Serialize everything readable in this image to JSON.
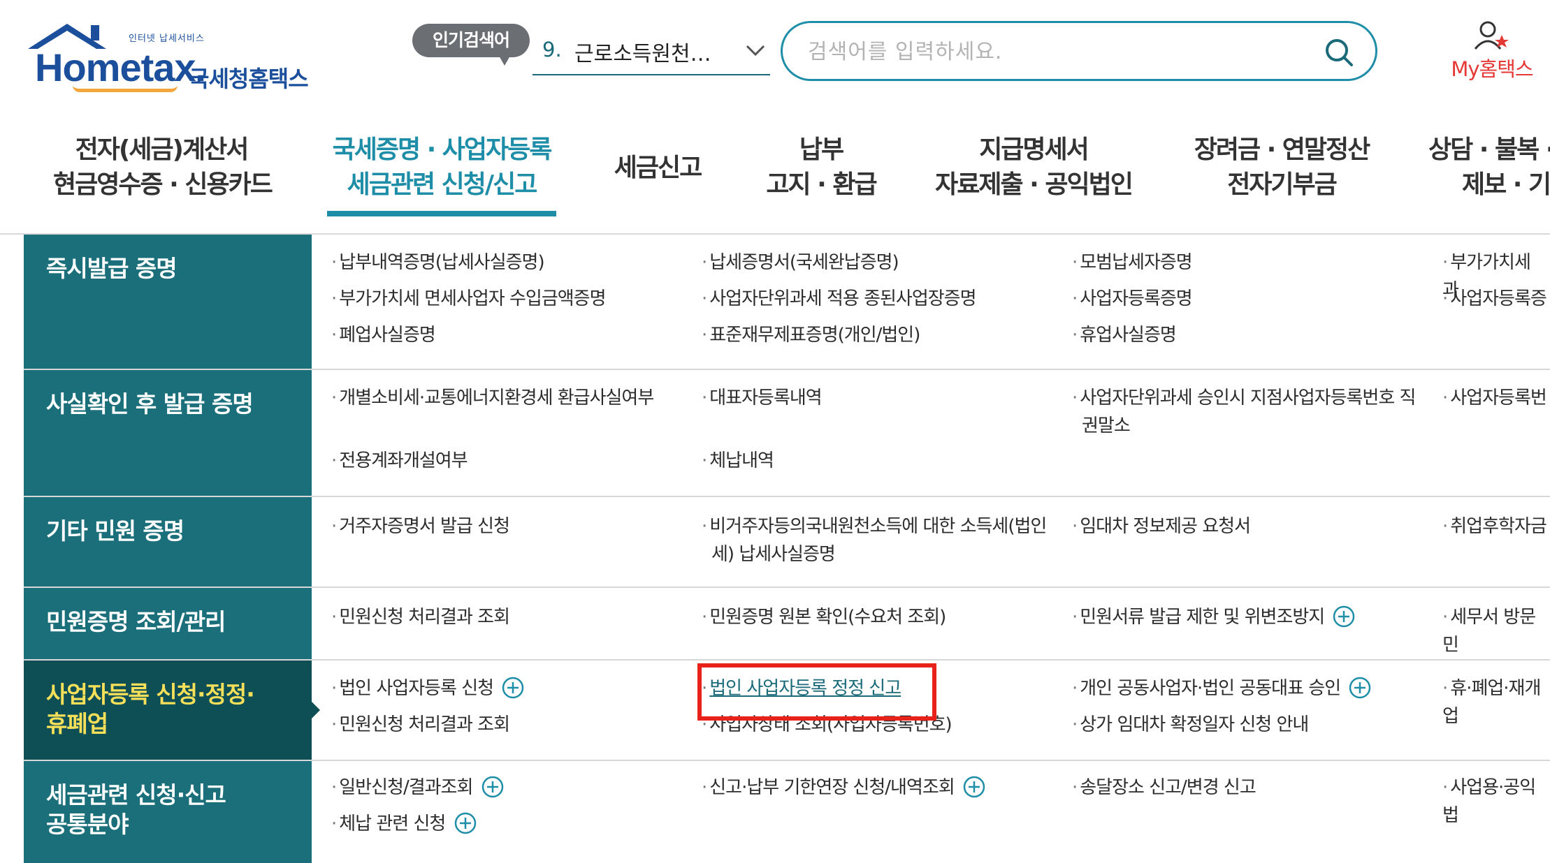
{
  "header": {
    "logo": {
      "tagline": "인터넷 납세서비스",
      "brand": "Hometax.",
      "brand_kr": "국세청홈택스"
    },
    "popular": {
      "badge": "인기검색어",
      "rank": "9.",
      "keyword": "근로소득원천…"
    },
    "search": {
      "placeholder": "검색어를 입력하세요."
    },
    "my": {
      "label": "My홈택스"
    }
  },
  "nav": {
    "tabs": [
      {
        "l1": "전자(세금)계산서",
        "l2": "현금영수증 · 신용카드"
      },
      {
        "l1": "국세증명 · 사업자등록",
        "l2": "세금관련 신청/신고",
        "active": true
      },
      {
        "l1": "세금신고",
        "l2": ""
      },
      {
        "l1": "납부",
        "l2": "고지 · 환급"
      },
      {
        "l1": "지급명세서",
        "l2": "자료제출 · 공익법인"
      },
      {
        "l1": "장려금 · 연말정산",
        "l2": "전자기부금"
      },
      {
        "l1": "상담 · 불복 ·",
        "l2": "제보 · 기"
      }
    ]
  },
  "menu": {
    "rows": [
      {
        "title": "즉시발급 증명",
        "items": [
          "납부내역증명(납세사실증명)",
          "납세증명서(국세완납증명)",
          "모범납세자증명",
          "부가가치세 과",
          "부가가치세 면세사업자 수입금액증명",
          "사업자단위과세 적용 종된사업장증명",
          "사업자등록증명",
          "사업자등록증",
          "폐업사실증명",
          "표준재무제표증명(개인/법인)",
          "휴업사실증명"
        ]
      },
      {
        "title": "사실확인 후 발급 증명",
        "items": [
          "개별소비세·교통에너지환경세 환급사실여부",
          "대표자등록내역",
          "사업자단위과세 승인시 지점사업자등록번호 직권말소",
          "사업자등록번",
          "전용계좌개설여부",
          "체납내역"
        ]
      },
      {
        "title": "기타 민원 증명",
        "items": [
          "거주자증명서 발급 신청",
          "비거주자등의국내원천소득에 대한 소득세(법인세) 납세사실증명",
          "임대차 정보제공 요청서",
          "취업후학자금"
        ]
      },
      {
        "title": "민원증명 조회/관리",
        "items": [
          "민원신청 처리결과 조회",
          "민원증명 원본 확인(수요처 조회)",
          "민원서류 발급 제한 및 위변조방지",
          "세무서 방문 민"
        ]
      },
      {
        "title_l1": "사업자등록 신청·정정·",
        "title_l2": "휴폐업",
        "items": [
          "법인 사업자등록 신청",
          "법인 사업자등록 정정 신고",
          "개인 공동사업자·법인 공동대표 승인",
          "휴·폐업·재개업",
          "민원신청 처리결과 조회",
          "사업자상태 조회(사업자등록번호)",
          "상가 임대차 확정일자 신청 안내"
        ]
      },
      {
        "title_l1": "세금관련 신청·신고",
        "title_l2": "공통분야",
        "items": [
          "일반신청/결과조회",
          "신고·납부 기한연장 신청/내역조회",
          "송달장소 신고/변경 신고",
          "사업용·공익법",
          "체납 관련 신청"
        ]
      }
    ]
  },
  "colors": {
    "teal": "#1a6f7a",
    "teal_dark": "#0e4e55",
    "accent": "#1e8ea8",
    "highlight": "#e8211b",
    "active_title": "#f6e05a"
  }
}
